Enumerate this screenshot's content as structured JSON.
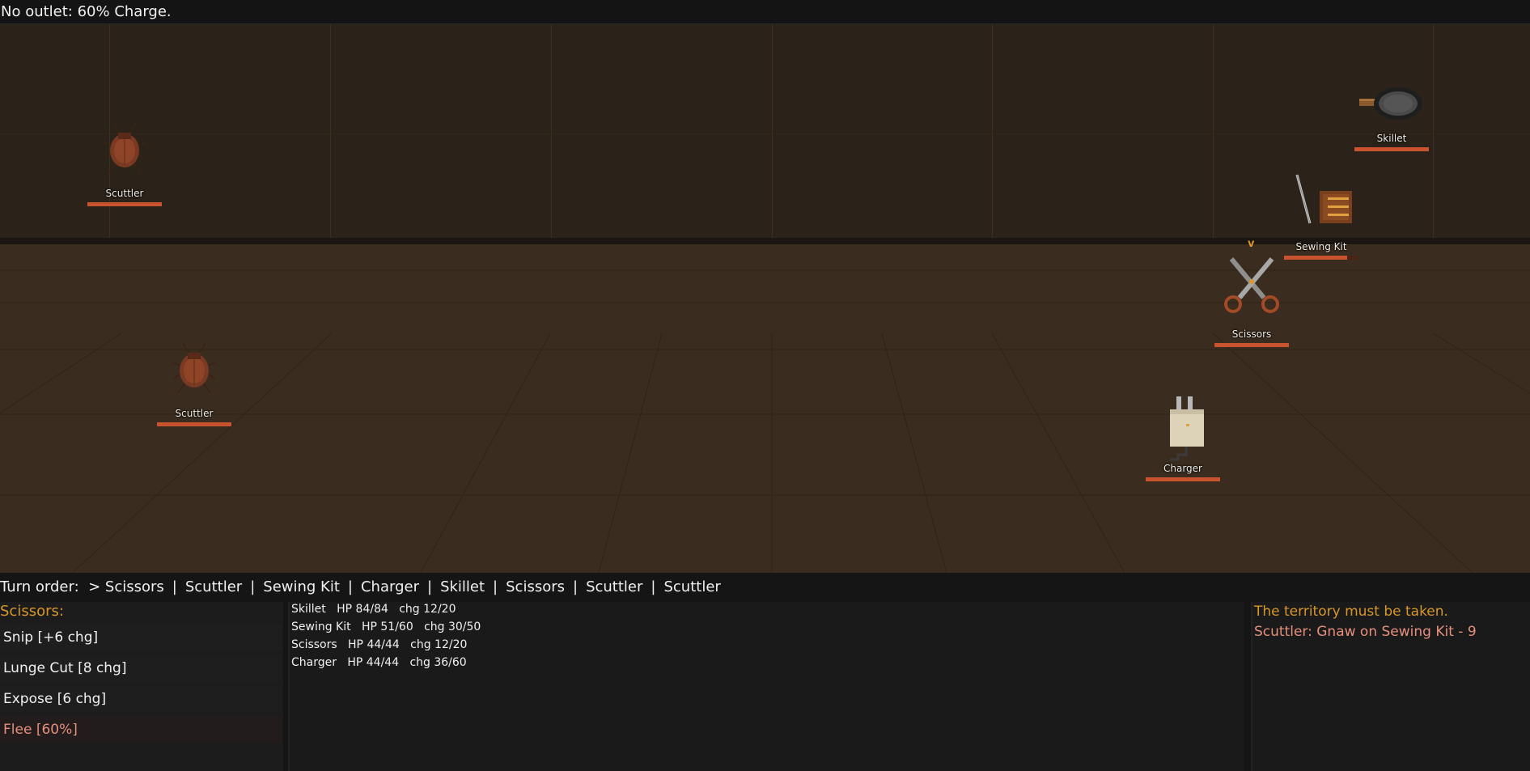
{
  "status": {
    "message": "No outlet: 60% Charge."
  },
  "colors": {
    "accent": "#d8962c",
    "hp": "#c9522f",
    "flee": "#e58f7c",
    "log_system": "#d8962c",
    "log_enemy": "#e58f7c"
  },
  "units": {
    "scuttler_top": {
      "name": "Scuttler",
      "hp_fraction": 1.0
    },
    "scuttler_floor": {
      "name": "Scuttler",
      "hp_fraction": 1.0
    },
    "skillet": {
      "name": "Skillet",
      "hp_fraction": 1.0
    },
    "sewing_kit": {
      "name": "Sewing Kit",
      "hp_fraction": 0.85
    },
    "scissors": {
      "name": "Scissors",
      "hp_fraction": 1.0
    },
    "charger": {
      "name": "Charger",
      "hp_fraction": 1.0
    }
  },
  "target_marker": "v",
  "turn_order": {
    "label": "Turn order:",
    "entries": [
      "> Scissors",
      "Scuttler",
      "Sewing Kit",
      "Charger",
      "Skillet",
      "Scissors",
      "Scuttler",
      "Scuttler"
    ],
    "separator": "|"
  },
  "actions": {
    "title": "Scissors:",
    "items": [
      {
        "label": "Snip  [+6 chg]"
      },
      {
        "label": "Lunge Cut  [8 chg]"
      },
      {
        "label": "Expose  [6 chg]"
      },
      {
        "label": "Flee  [60%]"
      }
    ]
  },
  "party": [
    {
      "text": "Skillet   HP 84/84   chg 12/20"
    },
    {
      "text": "Sewing Kit   HP 51/60   chg 30/50"
    },
    {
      "text": "Scissors   HP 44/44   chg 12/20"
    },
    {
      "text": "Charger   HP 44/44   chg 36/60"
    }
  ],
  "log": [
    {
      "text": "The territory must be taken.",
      "kind": "system"
    },
    {
      "text": "Scuttler: Gnaw on Sewing Kit - 9",
      "kind": "enemy"
    }
  ]
}
